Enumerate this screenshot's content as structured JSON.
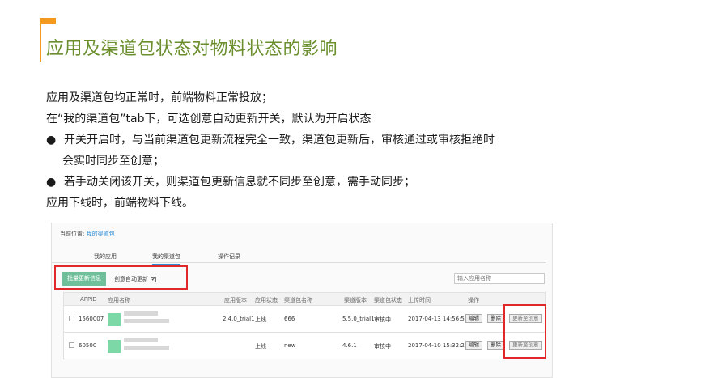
{
  "page": {
    "title": "应用及渠道包状态对物料状态的影响",
    "lines": [
      "应用及渠道包均正常时，前端物料正常投放；",
      "在“我的渠道包”tab下，可选创意自动更新开关，默认为开启状态"
    ],
    "bullets": [
      {
        "bullet": "●",
        "text": "开关开启时，与当前渠道包更新流程完全一致，渠道包更新后，审核通过或审核拒绝时",
        "continuation": "会实时同步至创意；"
      },
      {
        "bullet": "●",
        "text": "若手动关闭该开关，则渠道包更新信息就不同步至创意，需手动同步；"
      }
    ],
    "last_line": "应用下线时，前端物料下线。"
  },
  "screenshot": {
    "breadcrumb_label": "当前位置:",
    "breadcrumb_link": "我的渠道包",
    "tabs": [
      "我的应用",
      "我的渠道包",
      "操作记录"
    ],
    "batch_button": "批量更新信息",
    "auto_update_label": "创意自动更新",
    "auto_update_checked": "✔",
    "search_placeholder": "输入应用名称",
    "columns": [
      "APPID",
      "应用名称",
      "应用版本",
      "应用状态",
      "渠道包名称",
      "渠道版本",
      "渠道包状态",
      "上传时间",
      "操作"
    ],
    "rows": [
      {
        "appid": "1560007",
        "version": "2.4.0_trial1",
        "app_status": "上线",
        "pkg_name": "666",
        "pkg_version": "5.5.0_trial1",
        "pkg_status": "审核中",
        "upload_time": "2017-04-13 14:56:57"
      },
      {
        "appid": "60500",
        "version": "",
        "app_status": "上线",
        "pkg_name": "new",
        "pkg_version": "4.6.1",
        "pkg_status": "审核中",
        "upload_time": "2017-04-10 15:32:29"
      }
    ],
    "edit_label": "编辑",
    "delete_label": "删除",
    "sync_label": "更新至创意"
  },
  "colors": {
    "title_green": "#6a8f2c",
    "accent_orange": "#f39a1e",
    "highlight_red": "#e0282b",
    "button_green": "#6fc09a",
    "link_blue": "#2c8cd6"
  }
}
